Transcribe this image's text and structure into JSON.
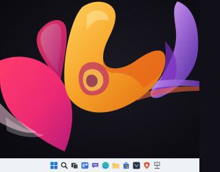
{
  "wallpaper": {
    "name": "windows-11-bloom-wallpaper",
    "colors": {
      "background": "#111018",
      "pink": "#ee2a73",
      "magenta": "#c1208a",
      "orange": "#f29a1e",
      "gold": "#f7c34a",
      "purple": "#7a3cc9",
      "violet": "#b27ae6"
    }
  },
  "taskbar": {
    "background": "#eef1f6",
    "icons": [
      {
        "name": "start-icon",
        "color": "#1673d9"
      },
      {
        "name": "search-icon",
        "color": "#222222"
      },
      {
        "name": "task-view-icon",
        "color": "#222222"
      },
      {
        "name": "widgets-icon",
        "color": "#3a6fd6"
      },
      {
        "name": "chat-icon",
        "color": "#5b5fc7"
      },
      {
        "name": "edge-icon",
        "color": "#1b9de2"
      },
      {
        "name": "file-explorer-icon",
        "color": "#f2b843"
      },
      {
        "name": "store-icon",
        "color": "#2b64d6"
      },
      {
        "name": "dark-app-icon",
        "color": "#2b2f3a"
      },
      {
        "name": "brave-icon",
        "color": "#e04c2a"
      },
      {
        "name": "network-device-icon",
        "color": "#4a5566"
      }
    ]
  }
}
